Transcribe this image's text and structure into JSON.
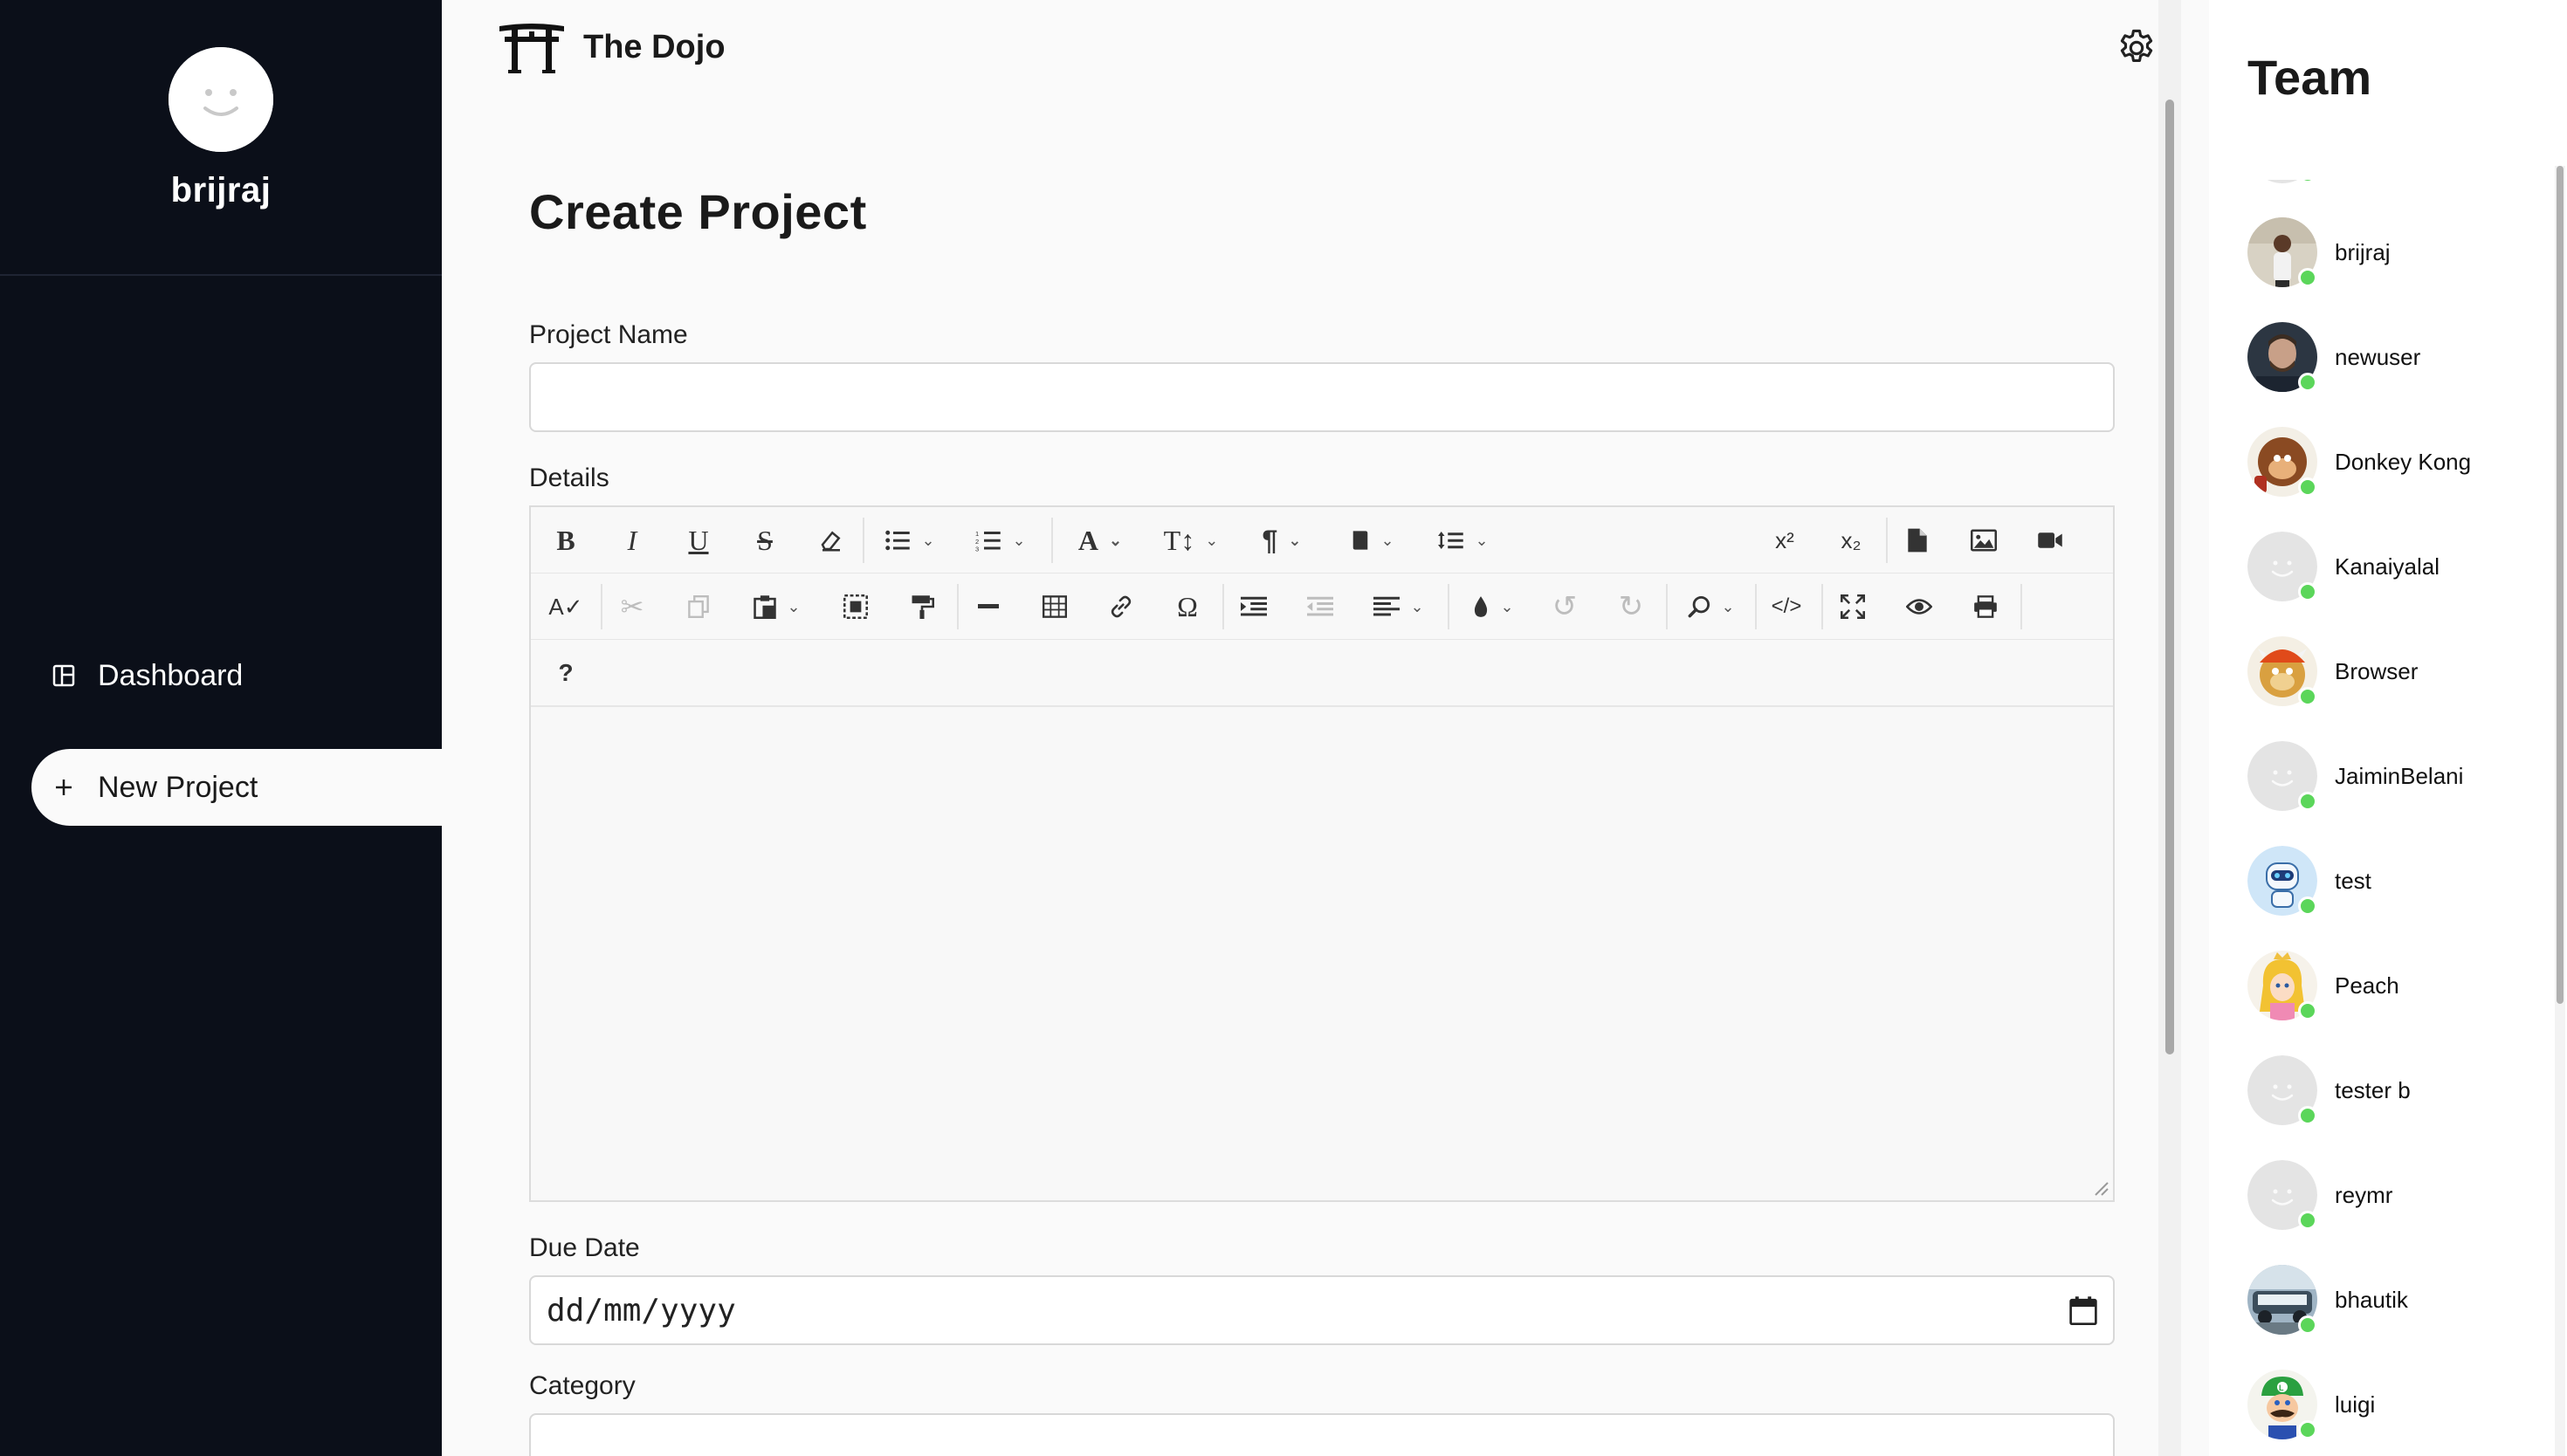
{
  "sidebar": {
    "username": "brijraj",
    "nav": [
      {
        "label": "Dashboard",
        "icon": "dashboard-icon"
      },
      {
        "label": "New Project",
        "icon": "plus-icon",
        "active": true
      }
    ]
  },
  "header": {
    "brand_name": "The Dojo",
    "brand_icon": "torii-gate-icon",
    "settings_icon": "gear-icon"
  },
  "form": {
    "title": "Create Project",
    "project_name_label": "Project Name",
    "project_name_value": "",
    "details_label": "Details",
    "due_date_label": "Due Date",
    "due_date_placeholder": "dd/mm/yyyy",
    "category_label": "Category"
  },
  "editor": {
    "help_label": "?",
    "superscript_label": "x²",
    "subscript_label": "x₂"
  },
  "team": {
    "title": "Team",
    "members": [
      {
        "name": "brijraj",
        "avatar": "photo",
        "online": true
      },
      {
        "name": "newuser",
        "avatar": "photo",
        "online": true
      },
      {
        "name": "Donkey Kong",
        "avatar": "photo",
        "online": true
      },
      {
        "name": "Kanaiyalal",
        "avatar": "default",
        "online": true
      },
      {
        "name": "Browser",
        "avatar": "photo",
        "online": true
      },
      {
        "name": "JaiminBelani",
        "avatar": "default",
        "online": true
      },
      {
        "name": "test",
        "avatar": "robot",
        "online": true
      },
      {
        "name": "Peach",
        "avatar": "photo",
        "online": true
      },
      {
        "name": "tester b",
        "avatar": "default",
        "online": true
      },
      {
        "name": "reymr",
        "avatar": "default",
        "online": true
      },
      {
        "name": "bhautik",
        "avatar": "photo",
        "online": true
      },
      {
        "name": "luigi",
        "avatar": "photo",
        "online": true
      }
    ]
  },
  "colors": {
    "sidebar_bg": "#0b0f19",
    "main_bg": "#fafafa",
    "online": "#5bd65a"
  }
}
